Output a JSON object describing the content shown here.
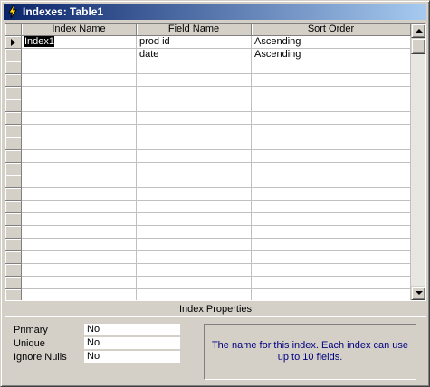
{
  "window": {
    "title": "Indexes: Table1",
    "title_icon": "lightning-icon"
  },
  "grid": {
    "columns": [
      "Index Name",
      "Field Name",
      "Sort Order"
    ],
    "rows": [
      {
        "index_name": "Index1",
        "field_name": "prod id",
        "sort_order": "Ascending",
        "current": true
      },
      {
        "index_name": "",
        "field_name": "date",
        "sort_order": "Ascending",
        "current": false
      }
    ],
    "empty_row_count": 19
  },
  "properties": {
    "heading": "Index Properties",
    "primary": {
      "label": "Primary",
      "value": "No"
    },
    "unique": {
      "label": "Unique",
      "value": "No"
    },
    "ignore_nulls": {
      "label": "Ignore Nulls",
      "value": "No"
    },
    "help_text": "The name for this index.  Each index can use up to 10 fields."
  },
  "colors": {
    "title_gradient_start": "#0a246a",
    "title_gradient_end": "#a6caf0",
    "help_text": "#00007f"
  }
}
